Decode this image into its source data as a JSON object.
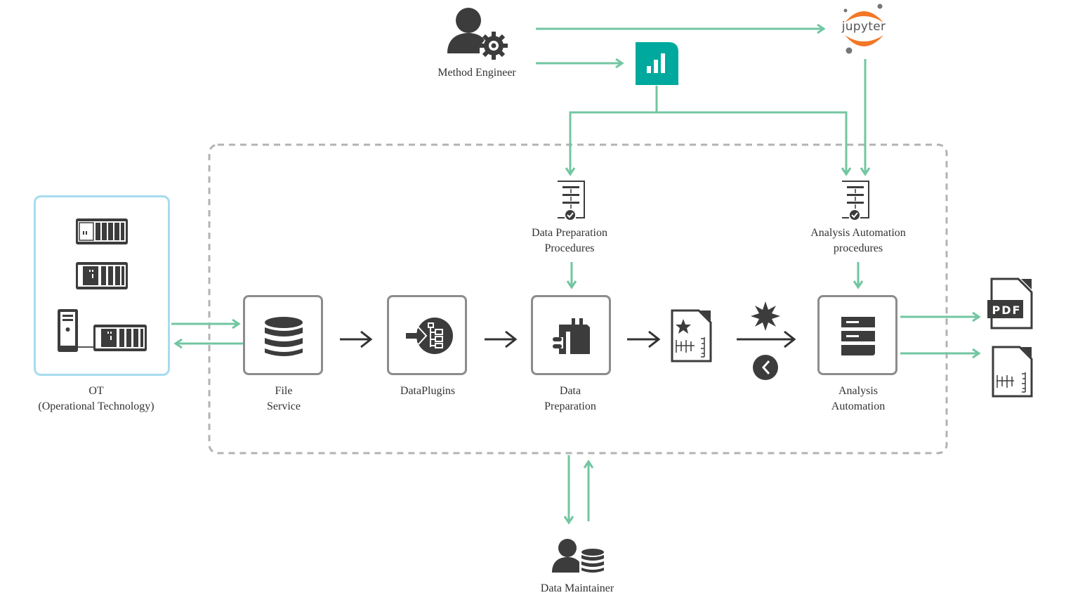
{
  "colors": {
    "flow_green": "#72c6a1",
    "dark_arrow": "#333333",
    "icon_dark": "#3c3c3c",
    "node_border": "#8c8c8c",
    "ot_border": "#a6dcee",
    "boundary_dash": "#b3b3b3",
    "teal_app": "#00a99d",
    "jupyter_orange": "#f37726"
  },
  "actors": {
    "method_engineer": {
      "label": "Method Engineer",
      "icon": "user-gear-icon"
    },
    "data_maintainer": {
      "label": "Data Maintainer",
      "icon": "user-database-icon"
    }
  },
  "tools": {
    "jupyter": {
      "label": "jupyter",
      "icon": "jupyter-logo-icon"
    },
    "analytics_app": {
      "icon": "bar-chart-app-icon"
    }
  },
  "ot": {
    "title": "OT",
    "subtitle": "(Operational Technology)",
    "devices": [
      "plc-rack-icon",
      "plc-rack-icon",
      "computer-plc-icon"
    ]
  },
  "procedures": {
    "data_prep": {
      "line1": "Data Preparation",
      "line2": "Procedures",
      "icon": "procedure-document-icon"
    },
    "analysis": {
      "line1": "Analysis Automation",
      "line2": "procedures",
      "icon": "procedure-document-icon"
    }
  },
  "pipeline": [
    {
      "id": "file-service",
      "line1": "File",
      "line2": "Service",
      "icon": "database-icon"
    },
    {
      "id": "dataplugins",
      "line1": "DataPlugins",
      "line2": "",
      "icon": "dataplugin-icon"
    },
    {
      "id": "data-preparation",
      "line1": "Data",
      "line2": "Preparation",
      "icon": "data-prep-icon"
    },
    {
      "id": "analysis-automation",
      "line1": "Analysis",
      "line2": "Automation",
      "icon": "analysis-stack-icon"
    }
  ],
  "triggers": [
    "event-burst-icon",
    "clock-icon"
  ],
  "outputs": [
    {
      "id": "pdf-report",
      "label": "PDF",
      "icon": "pdf-file-icon"
    },
    {
      "id": "data-file",
      "icon": "data-file-icon"
    }
  ],
  "intermediate": {
    "icon": "starred-data-file-icon"
  }
}
